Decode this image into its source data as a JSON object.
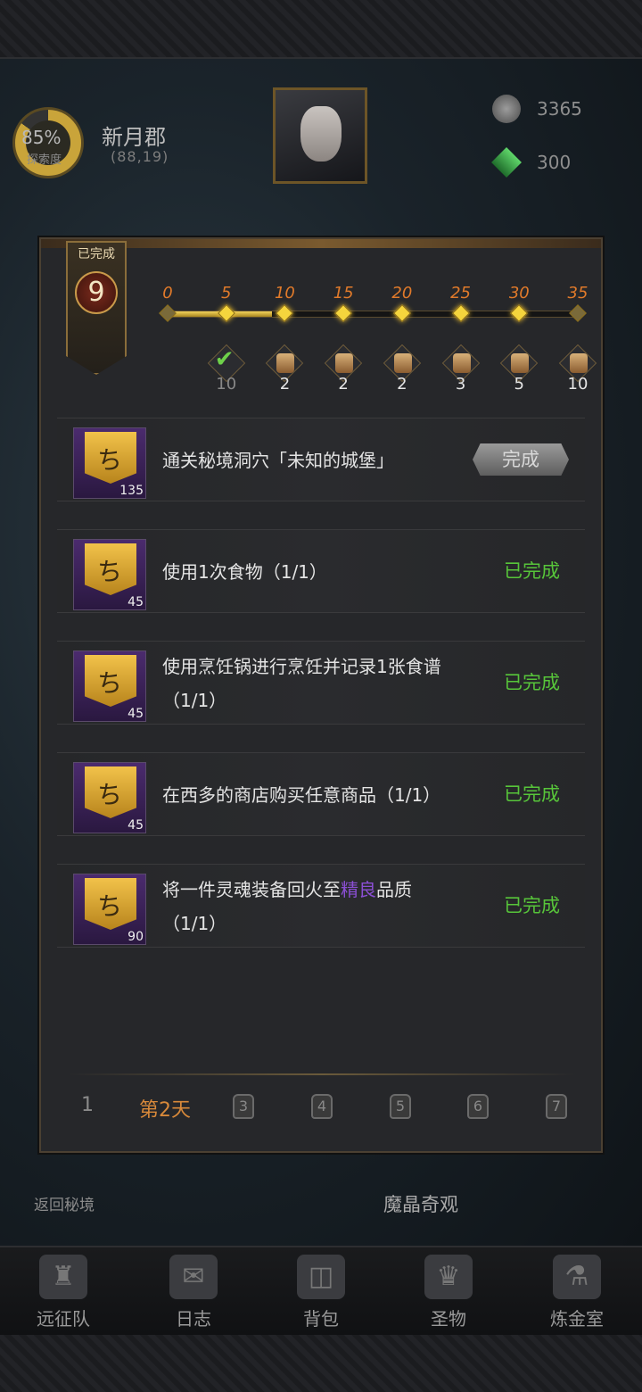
{
  "hud": {
    "explore_percent": "85%",
    "explore_label": "探索度",
    "location_name": "新月郡",
    "location_coords": "(88,19)",
    "resources": [
      {
        "icon": "coin-icon",
        "value": "3365"
      },
      {
        "icon": "gem-icon",
        "value": "300"
      }
    ]
  },
  "panel": {
    "badge_label": "已完成",
    "badge_value": "9",
    "progress": {
      "ticks": [
        "0",
        "5",
        "10",
        "15",
        "20",
        "25",
        "30",
        "35"
      ],
      "current": 9,
      "max": 35,
      "rewards": [
        {
          "icon": "claimed-check-icon",
          "count": "10",
          "claimed": true
        },
        {
          "icon": "scroll-icon",
          "count": "2",
          "claimed": false
        },
        {
          "icon": "scroll-icon",
          "count": "2",
          "claimed": false
        },
        {
          "icon": "scroll-icon",
          "count": "2",
          "claimed": false
        },
        {
          "icon": "scroll-icon",
          "count": "3",
          "claimed": false
        },
        {
          "icon": "scroll-icon",
          "count": "5",
          "claimed": false
        },
        {
          "icon": "scroll-icon",
          "count": "10",
          "claimed": false
        }
      ]
    },
    "tasks": [
      {
        "points": "135",
        "text": "通关秘境洞穴「未知的城堡」",
        "action": "完成"
      },
      {
        "points": "45",
        "text": "使用1次食物（1/1）",
        "status": "已完成"
      },
      {
        "points": "45",
        "text": "使用烹饪锅进行烹饪并记录1张食谱（1/1）",
        "status": "已完成"
      },
      {
        "points": "45",
        "text": "在西多的商店购买任意商品（1/1）",
        "status": "已完成"
      },
      {
        "points": "90",
        "text_before": "将一件灵魂装备回火至",
        "text_highlight": "精良",
        "text_after": "品质（1/1）",
        "status": "已完成"
      }
    ],
    "days": [
      "1",
      "第2天",
      "3",
      "4",
      "5",
      "6",
      "7"
    ],
    "active_day": "第2天"
  },
  "scene_buttons": {
    "return": "返回秘境",
    "wonder": "魔晶奇观"
  },
  "nav": [
    "远征队",
    "日志",
    "背包",
    "圣物",
    "炼金室"
  ],
  "colors": {
    "accent_gold": "#f5d53d",
    "complete_green": "#57c53a",
    "highlight_purple": "#8b4fd4",
    "tick_orange": "#e07a2a"
  }
}
